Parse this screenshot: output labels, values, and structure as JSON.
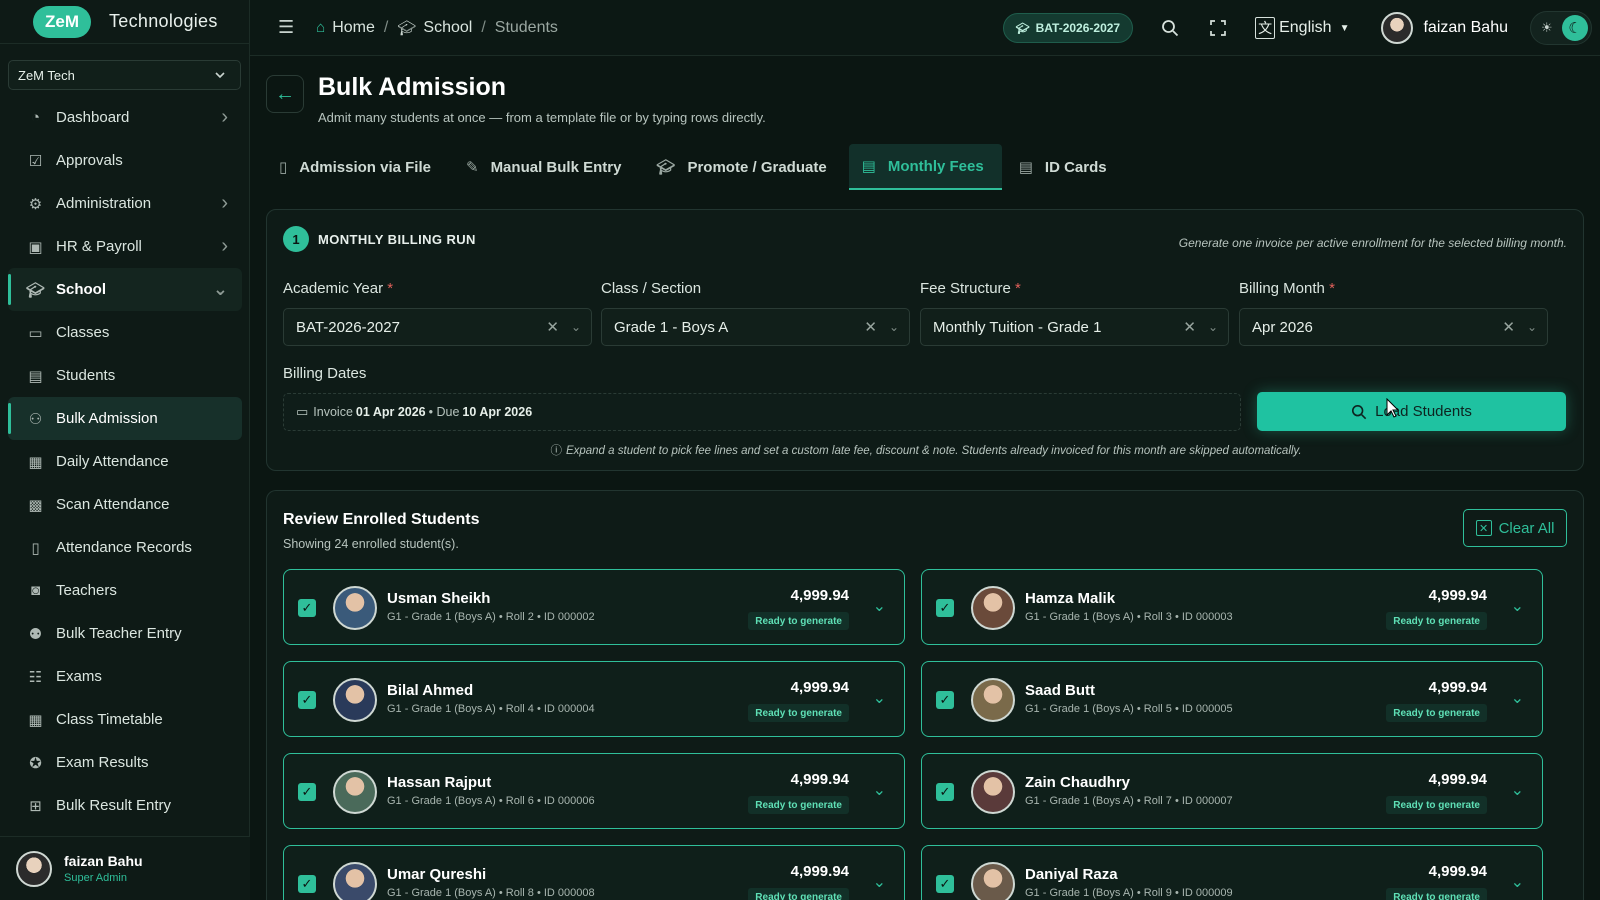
{
  "brand": {
    "logo": "ZeM",
    "name": "Technologies"
  },
  "org_select": {
    "value": "ZeM Tech"
  },
  "sidebar": {
    "items": [
      {
        "label": "Dashboard",
        "icon": "dashboard-icon",
        "has_chevron": true
      },
      {
        "label": "Approvals",
        "icon": "check-square-icon",
        "has_chevron": false
      },
      {
        "label": "Administration",
        "icon": "gear-icon",
        "has_chevron": true
      },
      {
        "label": "HR & Payroll",
        "icon": "id-badge-icon",
        "has_chevron": true
      },
      {
        "label": "School",
        "icon": "graduation-cap-icon",
        "has_chevron": true,
        "open": true
      },
      {
        "label": "Classes",
        "icon": "chalkboard-icon"
      },
      {
        "label": "Students",
        "icon": "id-card-icon"
      },
      {
        "label": "Bulk Admission",
        "icon": "user-plus-icon",
        "active": true
      },
      {
        "label": "Daily Attendance",
        "icon": "calendar-check-icon"
      },
      {
        "label": "Scan Attendance",
        "icon": "qr-code-icon"
      },
      {
        "label": "Attendance Records",
        "icon": "clipboard-icon"
      },
      {
        "label": "Teachers",
        "icon": "teacher-icon"
      },
      {
        "label": "Bulk Teacher Entry",
        "icon": "users-plus-icon"
      },
      {
        "label": "Exams",
        "icon": "exam-icon"
      },
      {
        "label": "Class Timetable",
        "icon": "calendar-icon"
      },
      {
        "label": "Exam Results",
        "icon": "award-icon"
      },
      {
        "label": "Bulk Result Entry",
        "icon": "table-icon"
      }
    ],
    "user": {
      "name": "faizan Bahu",
      "role": "Super Admin"
    }
  },
  "topbar": {
    "breadcrumb": {
      "home": "Home",
      "school": "School",
      "current": "Students"
    },
    "session": "BAT-2026-2027",
    "language": "English",
    "user_name": "faizan Bahu"
  },
  "page": {
    "title": "Bulk Admission",
    "subtitle": "Admit many students at once — from a template file or by typing rows directly."
  },
  "tabs": [
    {
      "label": "Admission via File",
      "icon": "file-upload-icon"
    },
    {
      "label": "Manual Bulk Entry",
      "icon": "edit-icon"
    },
    {
      "label": "Promote / Graduate",
      "icon": "graduation-cap-icon"
    },
    {
      "label": "Monthly Fees",
      "icon": "receipt-icon",
      "active": true
    },
    {
      "label": "ID Cards",
      "icon": "id-card-icon"
    }
  ],
  "billing": {
    "step": "1",
    "title": "MONTHLY BILLING RUN",
    "hint": "Generate one invoice per active enrollment for the selected billing month.",
    "fields": {
      "academic_year": {
        "label": "Academic Year",
        "value": "BAT-2026-2027"
      },
      "class_section": {
        "label": "Class / Section",
        "value": "Grade 1 - Boys A"
      },
      "fee_structure": {
        "label": "Fee Structure",
        "value": "Monthly Tuition - Grade 1"
      },
      "billing_month": {
        "label": "Billing Month",
        "value": "Apr 2026"
      }
    },
    "dates_label": "Billing Dates",
    "dates": {
      "invoice_prefix": "Invoice",
      "invoice_date": "01 Apr 2026",
      "due_prefix": "• Due",
      "due_date": "10 Apr 2026"
    },
    "load_button": "Load Students",
    "info": "Expand a student to pick fee lines and set a custom late fee, discount & note. Students already invoiced for this month are skipped automatically."
  },
  "review": {
    "title": "Review Enrolled Students",
    "subtitle": "Showing 24 enrolled student(s).",
    "clear_button": "Clear All",
    "students": [
      {
        "name": "Usman Sheikh",
        "meta": "G1 - Grade 1 (Boys A) • Roll 2 • ID 000002",
        "amount": "4,999.94",
        "status": "Ready to generate"
      },
      {
        "name": "Hamza Malik",
        "meta": "G1 - Grade 1 (Boys A) • Roll 3 • ID 000003",
        "amount": "4,999.94",
        "status": "Ready to generate"
      },
      {
        "name": "Bilal Ahmed",
        "meta": "G1 - Grade 1 (Boys A) • Roll 4 • ID 000004",
        "amount": "4,999.94",
        "status": "Ready to generate"
      },
      {
        "name": "Saad Butt",
        "meta": "G1 - Grade 1 (Boys A) • Roll 5 • ID 000005",
        "amount": "4,999.94",
        "status": "Ready to generate"
      },
      {
        "name": "Hassan Rajput",
        "meta": "G1 - Grade 1 (Boys A) • Roll 6 • ID 000006",
        "amount": "4,999.94",
        "status": "Ready to generate"
      },
      {
        "name": "Zain Chaudhry",
        "meta": "G1 - Grade 1 (Boys A) • Roll 7 • ID 000007",
        "amount": "4,999.94",
        "status": "Ready to generate"
      },
      {
        "name": "Umar Qureshi",
        "meta": "G1 - Grade 1 (Boys A) • Roll 8 • ID 000008",
        "amount": "4,999.94",
        "status": "Ready to generate"
      },
      {
        "name": "Daniyal Raza",
        "meta": "G1 - Grade 1 (Boys A) • Roll 9 • ID 000009",
        "amount": "4,999.94",
        "status": "Ready to generate"
      }
    ]
  },
  "colors": {
    "accent": "#2fbf9a",
    "background": "#0b1612",
    "surface": "#0e1b17",
    "required": "#e0605a"
  }
}
